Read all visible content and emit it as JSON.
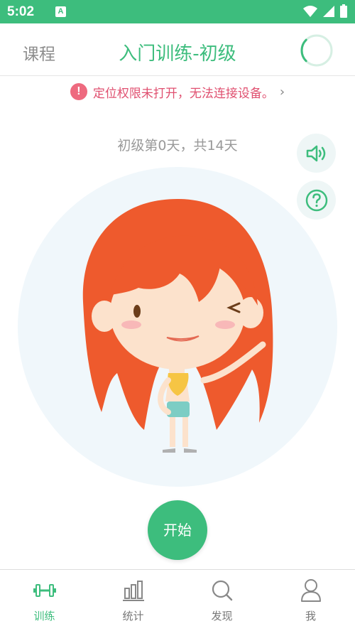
{
  "status_bar": {
    "time": "5:02",
    "notification_glyph": "A"
  },
  "header": {
    "left_label": "课程",
    "title": "入门训练-初级",
    "progress_fraction": 0.25
  },
  "alert": {
    "icon_text": "!",
    "text": "定位权限未打开，无法连接设备。",
    "chevron": "›"
  },
  "progress": {
    "text": "初级第0天，共14天"
  },
  "actions": {
    "sound": "speaker-icon",
    "help": "help-icon"
  },
  "start_button": {
    "label": "开始"
  },
  "bottom_nav": {
    "items": [
      {
        "label": "训练",
        "icon": "dumbbell-icon",
        "active": true
      },
      {
        "label": "统计",
        "icon": "bar-chart-icon",
        "active": false
      },
      {
        "label": "发现",
        "icon": "search-icon",
        "active": false
      },
      {
        "label": "我",
        "icon": "person-icon",
        "active": false
      }
    ]
  },
  "colors": {
    "accent": "#3dbd7d",
    "alert": "#e05070",
    "hair": "#ee5a2d"
  }
}
